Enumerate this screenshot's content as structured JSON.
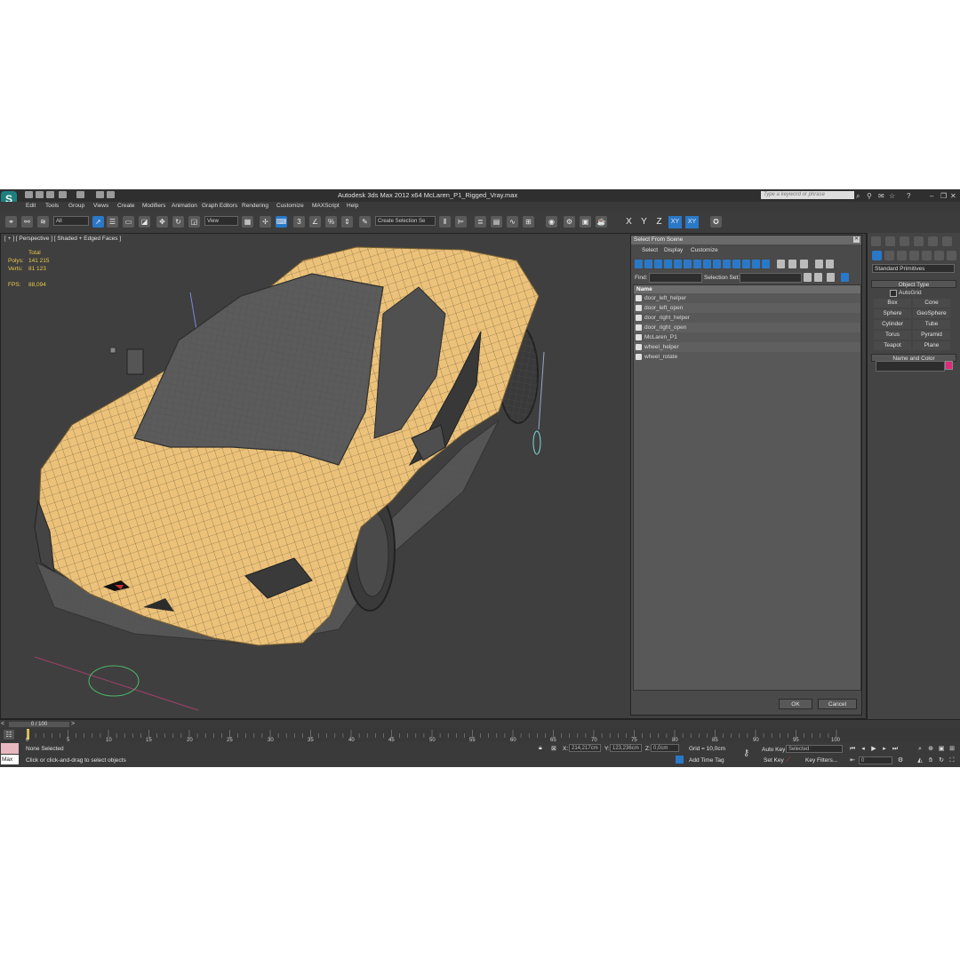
{
  "window": {
    "title": "Autodesk 3ds Max  2012 x64      McLaren_P1_Rigged_Vray.max",
    "search_placeholder": "Type a keyword or phrase"
  },
  "menu": [
    "Edit",
    "Tools",
    "Group",
    "Views",
    "Create",
    "Modifiers",
    "Animation",
    "Graph Editors",
    "Rendering",
    "Customize",
    "MAXScript",
    "Help"
  ],
  "toolbar": {
    "filter_value": "All",
    "refcoord_value": "View",
    "selection_set_placeholder": "Create Selection Se",
    "axes": [
      "X",
      "Y",
      "Z",
      "XY",
      "XY"
    ]
  },
  "viewport": {
    "label": "[ + ] [ Perspective ] [ Shaded + Edged Faces ]",
    "stats_header": "Total",
    "polys_label": "Polys:",
    "polys_value": "141 215",
    "verts_label": "Verts:",
    "verts_value": "81 123",
    "fps_label": "FPS:",
    "fps_value": "88,094"
  },
  "select_dialog": {
    "title": "Select From Scene",
    "menu": [
      "Select",
      "Display",
      "Customize"
    ],
    "find_label": "Find:",
    "selection_set_label": "Selection Set:",
    "column_header": "Name",
    "items": [
      "door_left_helper",
      "door_left_open",
      "door_right_helper",
      "door_right_open",
      "McLaren_P1",
      "wheel_helper",
      "wheel_rotate"
    ],
    "ok_label": "OK",
    "cancel_label": "Cancel"
  },
  "command_panel": {
    "category": "Standard Primitives",
    "object_type_label": "Object Type",
    "autogrid_label": "AutoGrid",
    "primitives": [
      "Box",
      "Cone",
      "Sphere",
      "GeoSphere",
      "Cylinder",
      "Tube",
      "Torus",
      "Pyramid",
      "Teapot",
      "Plane"
    ],
    "name_color_label": "Name and Color",
    "object_color": "#e0297a"
  },
  "timeline": {
    "slider_label": "0 / 100",
    "ticks": [
      "0",
      "5",
      "10",
      "15",
      "20",
      "25",
      "30",
      "35",
      "40",
      "45",
      "50",
      "55",
      "60",
      "65",
      "70",
      "75",
      "80",
      "85",
      "90",
      "95",
      "100"
    ]
  },
  "status": {
    "selection": "None Selected",
    "prompt": "Click or click-and-drag to select objects",
    "maxscript_label": "Max",
    "x_label": "X:",
    "x_value": "214,217cm",
    "y_label": "Y:",
    "y_value": "123,236cm",
    "z_label": "Z:",
    "z_value": "0,0cm",
    "grid": "Grid = 10,0cm",
    "auto_key": "Auto Key",
    "set_key": "Set Key",
    "key_mode_value": "Selected",
    "key_filters": "Key Filters...",
    "add_time_tag": "Add Time Tag",
    "frame_value": "0"
  }
}
